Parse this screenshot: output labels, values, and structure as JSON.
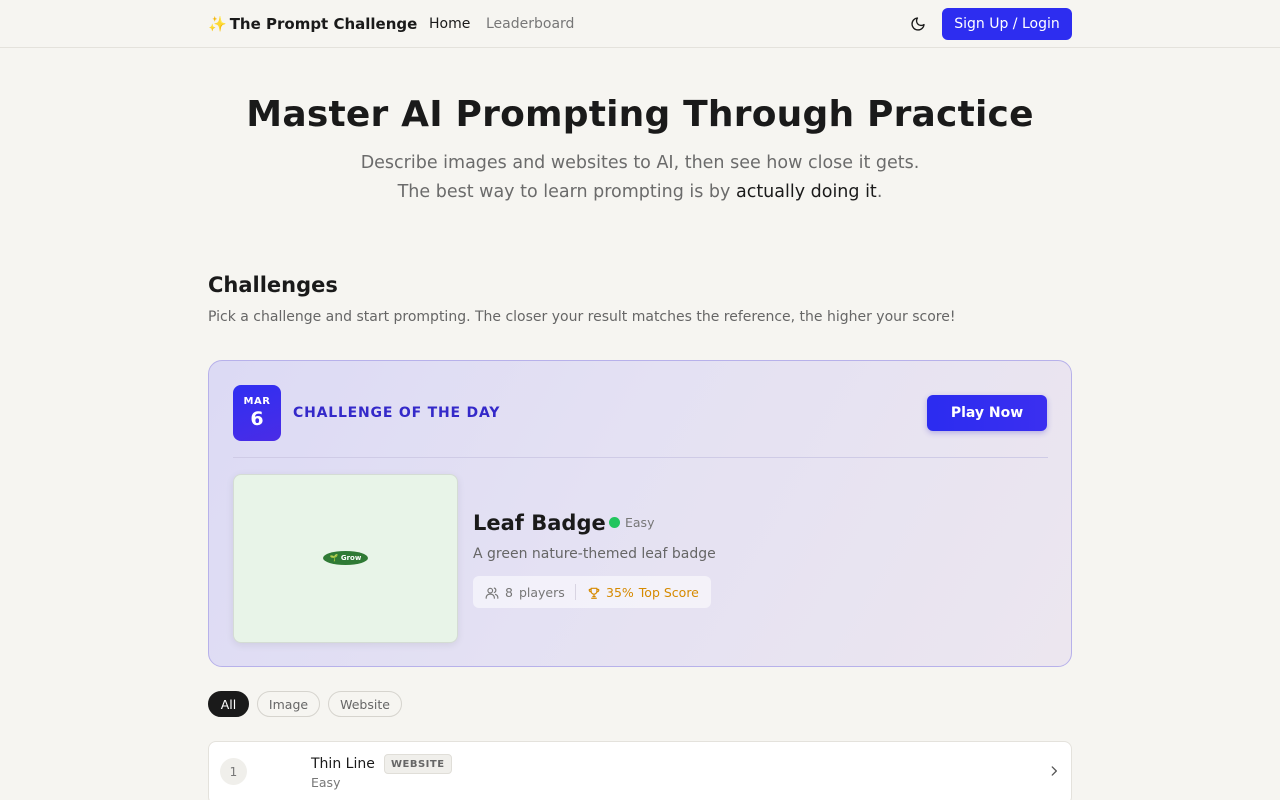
{
  "nav": {
    "brand_icon": "✨",
    "brand": "The Prompt Challenge",
    "links": [
      "Home",
      "Leaderboard"
    ],
    "theme_icon": "moon-icon",
    "signup_label": "Sign Up / Login"
  },
  "hero": {
    "title": "Master AI Prompting Through Practice",
    "line1": "Describe images and websites to AI, then see how close it gets.",
    "line2_prefix": "The best way to learn prompting is by ",
    "line2_emphasis": "actually doing it",
    "line2_suffix": "."
  },
  "challenges": {
    "title": "Challenges",
    "description": "Pick a challenge and start prompting. The closer your result matches the reference, the higher your score!"
  },
  "daily": {
    "month": "MAR",
    "day": "6",
    "label": "CHALLENGE OF THE DAY",
    "play_label": "Play Now",
    "preview_text": "🌱 Grow",
    "name": "Leaf Badge",
    "difficulty": "Easy",
    "description": "A green nature-themed leaf badge",
    "players_count": "8",
    "players_label": "players",
    "top_score": "35%",
    "top_score_label": "Top Score"
  },
  "filters": [
    "All",
    "Image",
    "Website"
  ],
  "rows": [
    {
      "rank": "1",
      "title": "Thin Line",
      "tag": "WEBSITE",
      "difficulty": "Easy"
    }
  ],
  "colors": {
    "accent": "#2d2df0",
    "easy": "#22c55e",
    "score": "#d68a00",
    "leaf": "#2f7a35"
  }
}
